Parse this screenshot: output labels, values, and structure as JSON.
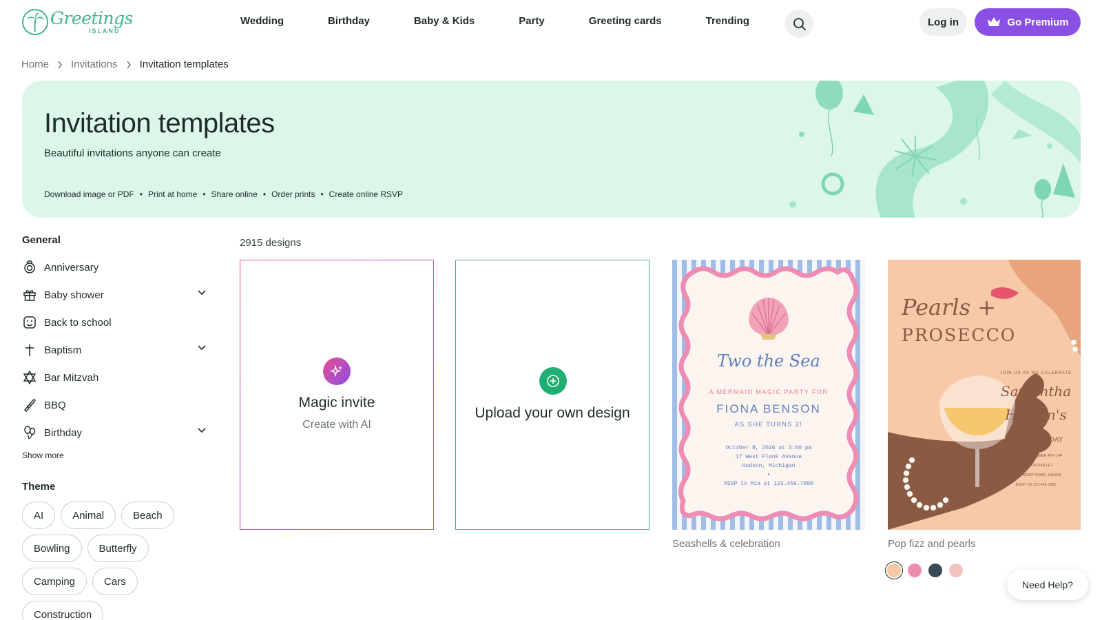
{
  "logo": {
    "word": "Greetings",
    "sub": "ISLAND"
  },
  "nav": {
    "items": [
      "Wedding",
      "Birthday",
      "Baby & Kids",
      "Party",
      "Greeting cards",
      "Trending"
    ],
    "search_icon": "search-icon"
  },
  "auth": {
    "login_label": "Log in",
    "premium_label": "Go Premium",
    "premium_icon": "crown-icon"
  },
  "breadcrumb": {
    "items": [
      "Home",
      "Invitations",
      "Invitation templates"
    ]
  },
  "hero": {
    "title": "Invitation templates",
    "subtitle": "Beautiful invitations anyone can create",
    "features": [
      "Download image or PDF",
      "Print at home",
      "Share online",
      "Order prints",
      "Create online RSVP"
    ]
  },
  "sidebar": {
    "general_heading": "General",
    "items": [
      {
        "label": "Anniversary",
        "icon": "rings-icon",
        "expandable": false
      },
      {
        "label": "Baby shower",
        "icon": "gift-icon",
        "expandable": true
      },
      {
        "label": "Back to school",
        "icon": "backpack-icon",
        "expandable": false
      },
      {
        "label": "Baptism",
        "icon": "cross-icon",
        "expandable": true
      },
      {
        "label": "Bar Mitzvah",
        "icon": "star-of-david-icon",
        "expandable": false
      },
      {
        "label": "BBQ",
        "icon": "grill-icon",
        "expandable": false
      },
      {
        "label": "Birthday",
        "icon": "balloons-icon",
        "expandable": true
      }
    ],
    "show_more": "Show more",
    "theme_heading": "Theme",
    "themes": [
      "AI",
      "Animal",
      "Beach",
      "Bowling",
      "Butterfly",
      "Camping",
      "Cars",
      "Construction"
    ]
  },
  "main": {
    "designs_count": "2915 designs",
    "magic": {
      "title": "Magic invite",
      "subtitle": "Create with AI"
    },
    "upload": {
      "title": "Upload your own design"
    },
    "templates": [
      {
        "caption": "Seashells & celebration",
        "heading": "Two the Sea",
        "line1": "A MERMAID MAGIC PARTY FOR",
        "name": "FIONA BENSON",
        "line2": "AS SHE TURNS 2!",
        "date": "October 8, 2026 at 3:00 pm",
        "address1": "17 West Plank Avenue",
        "address2": "Hudson, Michigan",
        "rsvp": "RSVP to Mia at 123.456.7890"
      },
      {
        "caption": "Pop fizz and pearls",
        "heading1": "Pearls +",
        "heading2": "PROSECCO",
        "line1": "JOIN US AS WE CELEBRATE",
        "name1": "Samantha",
        "name2": "Huston's",
        "line2": "35TH BIRTHDAY",
        "date": "SUNDAY | OCTOBER 4TH | 4P",
        "venue": "THE IRON SKILLET",
        "address": "149 CHERRY ROAD, SALEM",
        "rsvp": "RSVP TO 123.456.7890",
        "swatches": [
          "#f3c9a6",
          "#ee8cb0",
          "#3b4a57",
          "#f2c4c0"
        ]
      }
    ]
  },
  "help": {
    "label": "Need Help?"
  },
  "colors": {
    "brand": "#3fb58f",
    "premium": "#8a4fe4",
    "hero_bg": "#dcf7ea"
  }
}
